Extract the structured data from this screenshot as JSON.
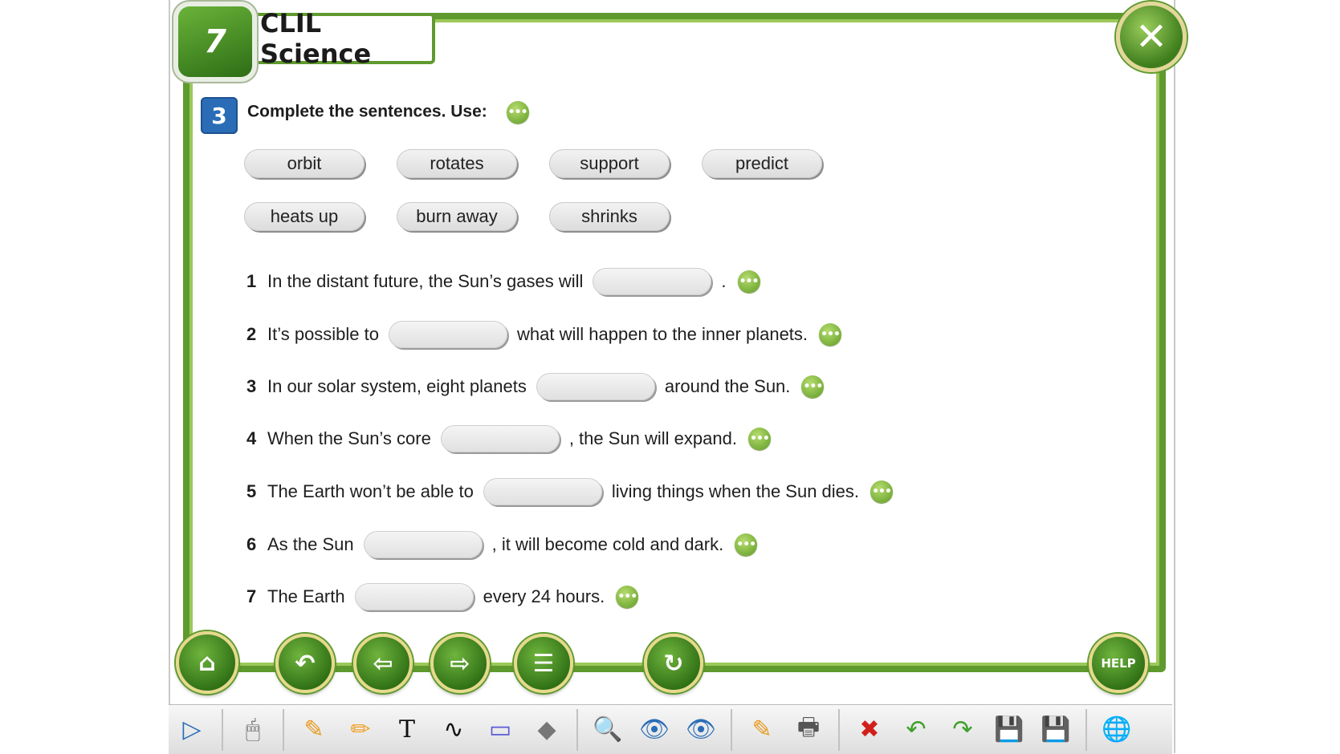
{
  "header": {
    "unit_number": "7",
    "title": "CLIL Science",
    "close_glyph": "✕"
  },
  "exercise": {
    "number": "3",
    "instruction": "Complete the sentences. Use:",
    "more_glyph": "•••"
  },
  "word_bank": [
    "orbit",
    "rotates",
    "support",
    "predict",
    "heats up",
    "burn away",
    "shrinks"
  ],
  "sentences": [
    {
      "num": "1",
      "before": "In the distant future, the Sun’s gases will",
      "after": "."
    },
    {
      "num": "2",
      "before": "It’s possible to",
      "after": "what will happen to the inner planets."
    },
    {
      "num": "3",
      "before": "In our solar system, eight planets",
      "after": "around the Sun."
    },
    {
      "num": "4",
      "before": "When the Sun’s core",
      "after": ", the Sun will expand."
    },
    {
      "num": "5",
      "before": "The Earth won’t be able to",
      "after": "living things when the Sun dies."
    },
    {
      "num": "6",
      "before": "As the Sun",
      "after": ", it will become cold and dark."
    },
    {
      "num": "7",
      "before": "The Earth",
      "after": "every 24 hours."
    }
  ],
  "nav": {
    "home_icon": "⌂",
    "back_icon": "↶",
    "prev_icon": "⇦",
    "next_icon": "⇨",
    "list_icon": "☰",
    "reset_icon": "↻",
    "help_label": "HELP"
  },
  "toolbar": {
    "icons": [
      "▷",
      "🖱",
      "✎",
      "✏",
      "T",
      "∿",
      "▭",
      "◆",
      "🔍",
      "👁",
      "👁",
      "✎",
      "🖶",
      "✖",
      "↶",
      "↷",
      "💾",
      "💾",
      "🌐"
    ]
  }
}
